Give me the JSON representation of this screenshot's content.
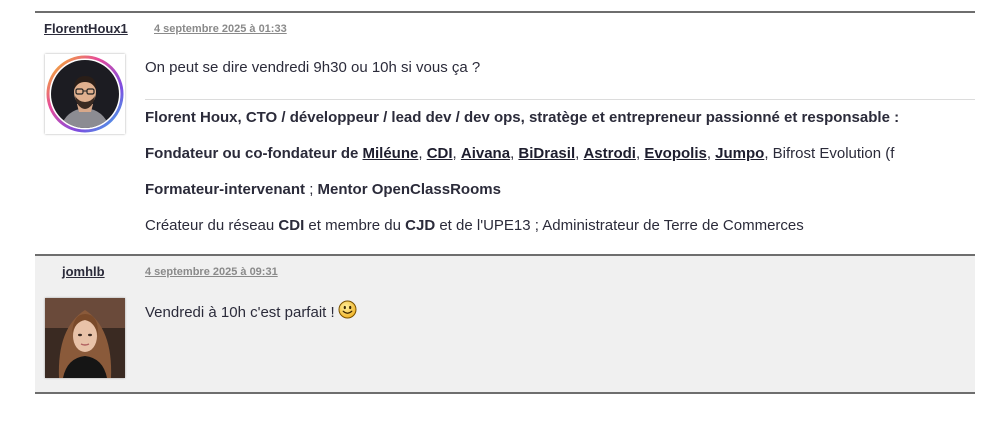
{
  "posts": [
    {
      "author": "FlorentHoux1",
      "date": "4 septembre 2025 à 01:33",
      "message": "On peut se dire vendredi 9h30 ou 10h si vous ça ?",
      "signature": {
        "line1": "Florent Houx, CTO / développeur / lead dev / dev ops, stratège et entrepreneur passionné et responsable :",
        "line2_prefix": "Fondateur ou co-fondateur de ",
        "line2_links": [
          "Miléune",
          "CDI",
          "Aivana",
          "BiDrasil",
          "Astrodi",
          "Evopolis",
          "Jumpo"
        ],
        "line2_separator": ", ",
        "line2_suffix": ", Bifrost Evolution (f",
        "line3_part1": "Formateur-intervenant",
        "line3_sep": " ; ",
        "line3_part2": "Mentor OpenClassRooms",
        "line4_prefix": "Créateur du réseau ",
        "line4_bold1": "CDI",
        "line4_mid": " et membre du ",
        "line4_bold2": "CJD",
        "line4_suffix": " et de l'UPE13 ; Administrateur de Terre de Commerces"
      }
    },
    {
      "author": "jomhlb",
      "date": "4 septembre 2025 à 09:31",
      "message": "Vendredi à 10h c'est parfait !",
      "emoji": "smiley-icon"
    }
  ],
  "colors": {
    "divider": "#6e6e6e",
    "alt_background": "#f0f0f0",
    "date_text": "#8a8a8a",
    "text": "#2b2b3a"
  }
}
